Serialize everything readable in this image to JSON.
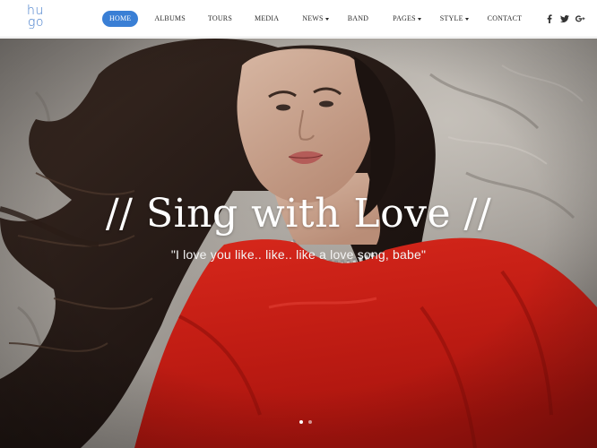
{
  "brand": {
    "logo_line1": "hu",
    "logo_line2": "go",
    "accent_color": "#3a7fd5"
  },
  "nav": {
    "items": [
      {
        "label": "HOME",
        "active": true,
        "has_dropdown": false
      },
      {
        "label": "ALBUMS",
        "active": false,
        "has_dropdown": false
      },
      {
        "label": "TOURS",
        "active": false,
        "has_dropdown": false
      },
      {
        "label": "MEDIA",
        "active": false,
        "has_dropdown": false
      },
      {
        "label": "NEWS",
        "active": false,
        "has_dropdown": true
      },
      {
        "label": "BAND",
        "active": false,
        "has_dropdown": false
      },
      {
        "label": "PAGES",
        "active": false,
        "has_dropdown": true
      },
      {
        "label": "STYLE",
        "active": false,
        "has_dropdown": true
      },
      {
        "label": "CONTACT",
        "active": false,
        "has_dropdown": false
      }
    ]
  },
  "social": {
    "icons": [
      "facebook-icon",
      "twitter-icon",
      "google-plus-icon"
    ]
  },
  "hero": {
    "title": "// Sing with Love //",
    "subtitle": "\"I love you like.. like.. like a love song, babe\"",
    "slides": 2,
    "active_slide": 1
  }
}
